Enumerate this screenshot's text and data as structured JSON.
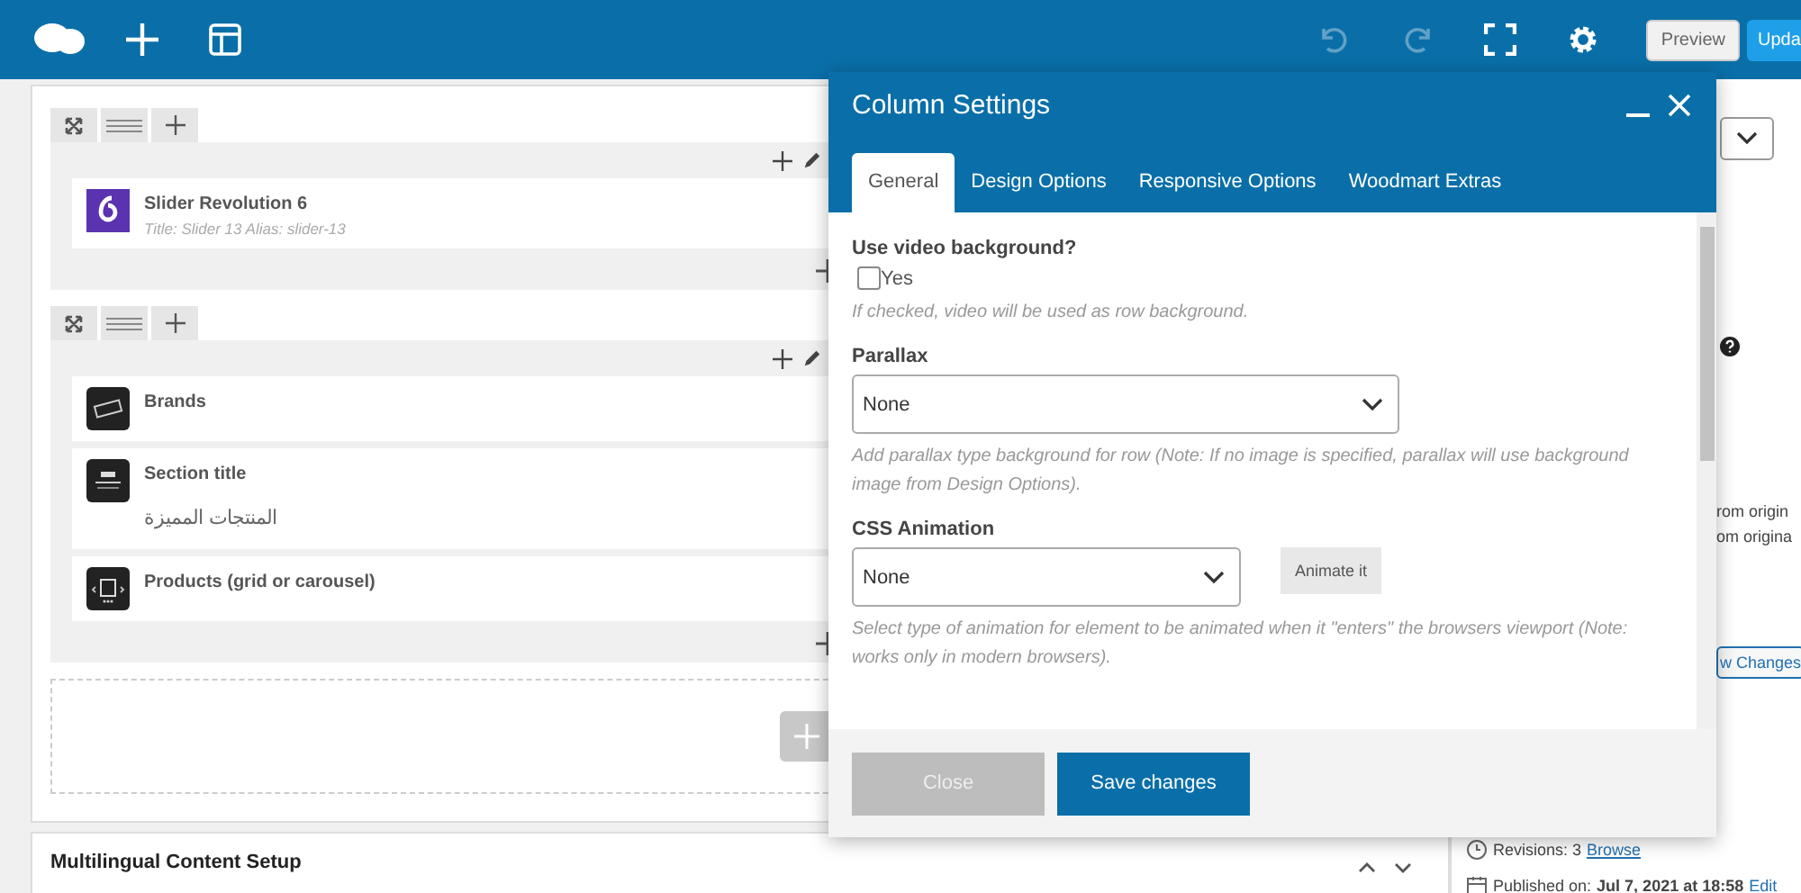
{
  "toolbar": {
    "preview": "Preview",
    "update": "Upda"
  },
  "rows": [
    {
      "elements": [
        {
          "kind": "slider",
          "title": "Slider Revolution 6",
          "subtitle": "Title: Slider 13  Alias: slider-13"
        }
      ]
    },
    {
      "elements": [
        {
          "kind": "brands",
          "title": "Brands"
        },
        {
          "kind": "section_title",
          "title": "Section title",
          "subtitle": "المنتجات المميزة"
        },
        {
          "kind": "products",
          "title": "Products (grid or carousel)"
        }
      ]
    }
  ],
  "bottom_panel": {
    "title": "Multilingual Content Setup"
  },
  "sidebar": {
    "fragments": [
      "rom origin",
      "om origina"
    ],
    "changes_button": "w Changes",
    "revisions": "Revisions: 3",
    "revisions_link": "Browse",
    "published_label": "Published on:",
    "published_date": "Jul 7, 2021 at 18:58",
    "published_link": "Edit"
  },
  "modal": {
    "title": "Column Settings",
    "tabs": [
      {
        "label": "General",
        "selected": true
      },
      {
        "label": "Design Options",
        "selected": false
      },
      {
        "label": "Responsive Options",
        "selected": false
      },
      {
        "label": "Woodmart Extras",
        "selected": false
      }
    ],
    "fields": [
      {
        "kind": "checkbox",
        "label": "Use video background?",
        "option": "Yes",
        "checked": false,
        "help": "If checked, video will be used as row background."
      },
      {
        "kind": "select",
        "label": "Parallax",
        "value": "None",
        "help": "Add parallax type background for row (Note: If no image is specified, parallax will use background image from Design Options)."
      },
      {
        "kind": "select_button",
        "label": "CSS Animation",
        "value": "None",
        "button": "Animate it",
        "help": "Select type of animation for element to be animated when it \"enters\" the browsers viewport (Note: works only in modern browsers)."
      }
    ],
    "close": "Close",
    "save": "Save changes"
  }
}
